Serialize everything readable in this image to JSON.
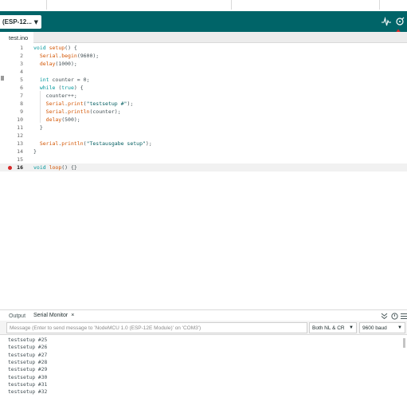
{
  "toolbar": {
    "board_label": "(ESP-12...",
    "serial_plotter_icon": "pulse-icon",
    "serial_monitor_icon": "magnifier-icon",
    "accent": "#006468"
  },
  "annotation": {
    "arrow_color": "#d62828"
  },
  "tabs": {
    "file": "test.ino"
  },
  "editor": {
    "current_line": 16,
    "breakpoint_line": 16,
    "lines": [
      {
        "n": "1",
        "html": "<span class='kw'>void</span> <span class='fn'>setup</span>() {"
      },
      {
        "n": "2",
        "html": "  <span class='fn'>Serial</span>.<span class='fn'>begin</span>(9600);"
      },
      {
        "n": "3",
        "html": "  <span class='fn'>delay</span>(1000);"
      },
      {
        "n": "4",
        "html": ""
      },
      {
        "n": "5",
        "html": "  <span class='ty'>int</span> counter = 0;"
      },
      {
        "n": "6",
        "html": "  <span class='kw'>while</span> (<span class='kw'>true</span>) {"
      },
      {
        "n": "7",
        "html": "    counter++;"
      },
      {
        "n": "8",
        "html": "    <span class='fn'>Serial</span>.<span class='fn'>print</span>(<span class='st'>\"testsetup #\"</span>);"
      },
      {
        "n": "9",
        "html": "    <span class='fn'>Serial</span>.<span class='fn'>println</span>(counter);"
      },
      {
        "n": "10",
        "html": "    <span class='fn'>delay</span>(500);"
      },
      {
        "n": "11",
        "html": "  }"
      },
      {
        "n": "12",
        "html": ""
      },
      {
        "n": "13",
        "html": "  <span class='fn'>Serial</span>.<span class='fn'>println</span>(<span class='st'>\"Testausgabe setup\"</span>);"
      },
      {
        "n": "14",
        "html": "}"
      },
      {
        "n": "15",
        "html": ""
      },
      {
        "n": "16",
        "html": "<span class='kw'>void</span> <span class='fn'>loop</span>() {}"
      }
    ]
  },
  "bottom_panel": {
    "tab_output": "Output",
    "tab_serial_monitor": "Serial Monitor",
    "close_glyph": "×",
    "message_placeholder": "Message (Enter to send message to 'NodeMCU 1.0 (ESP-12E Module)' on 'COM3')",
    "line_ending": "Both NL & CR",
    "baud": "9600 baud",
    "output_lines": [
      "testsetup #25",
      "testsetup #26",
      "testsetup #27",
      "testsetup #28",
      "testsetup #29",
      "testsetup #30",
      "testsetup #31",
      "testsetup #32"
    ]
  }
}
